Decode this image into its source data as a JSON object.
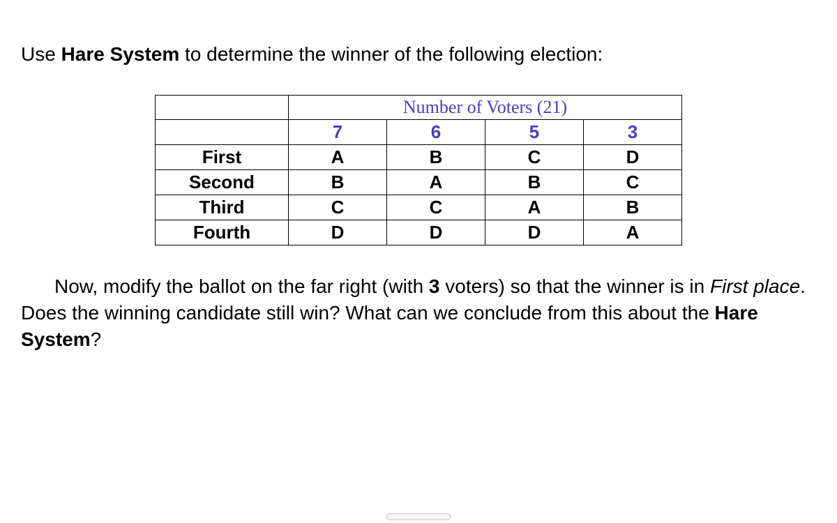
{
  "intro": {
    "before": "Use ",
    "boldTerm": "Hare System",
    "after": " to determine the winner of the following election:"
  },
  "table": {
    "headerLabel": "Number of Voters (21)",
    "counts": [
      "7",
      "6",
      "5",
      "3"
    ],
    "rows": [
      {
        "label": "First",
        "cells": [
          "A",
          "B",
          "C",
          "D"
        ]
      },
      {
        "label": "Second",
        "cells": [
          "B",
          "A",
          "B",
          "C"
        ]
      },
      {
        "label": "Third",
        "cells": [
          "C",
          "C",
          "A",
          "B"
        ]
      },
      {
        "label": "Fourth",
        "cells": [
          "D",
          "D",
          "D",
          "A"
        ]
      }
    ]
  },
  "question": {
    "part1a": "Now, modify the ballot on the far right (with ",
    "bold3": "3",
    "part1b": " voters) so that the winner is in ",
    "italFirst": "First place",
    "part2": ".   Does the winning candidate still win?   What can we conclude from this about the ",
    "boldHare": "Hare System",
    "part3": "?"
  },
  "chart_data": {
    "type": "table",
    "title": "Number of Voters (21)",
    "categories": [
      "7",
      "6",
      "5",
      "3"
    ],
    "series": [
      {
        "name": "First",
        "values": [
          "A",
          "B",
          "C",
          "D"
        ]
      },
      {
        "name": "Second",
        "values": [
          "B",
          "A",
          "B",
          "C"
        ]
      },
      {
        "name": "Third",
        "values": [
          "C",
          "C",
          "A",
          "B"
        ]
      },
      {
        "name": "Fourth",
        "values": [
          "D",
          "D",
          "D",
          "A"
        ]
      }
    ]
  }
}
